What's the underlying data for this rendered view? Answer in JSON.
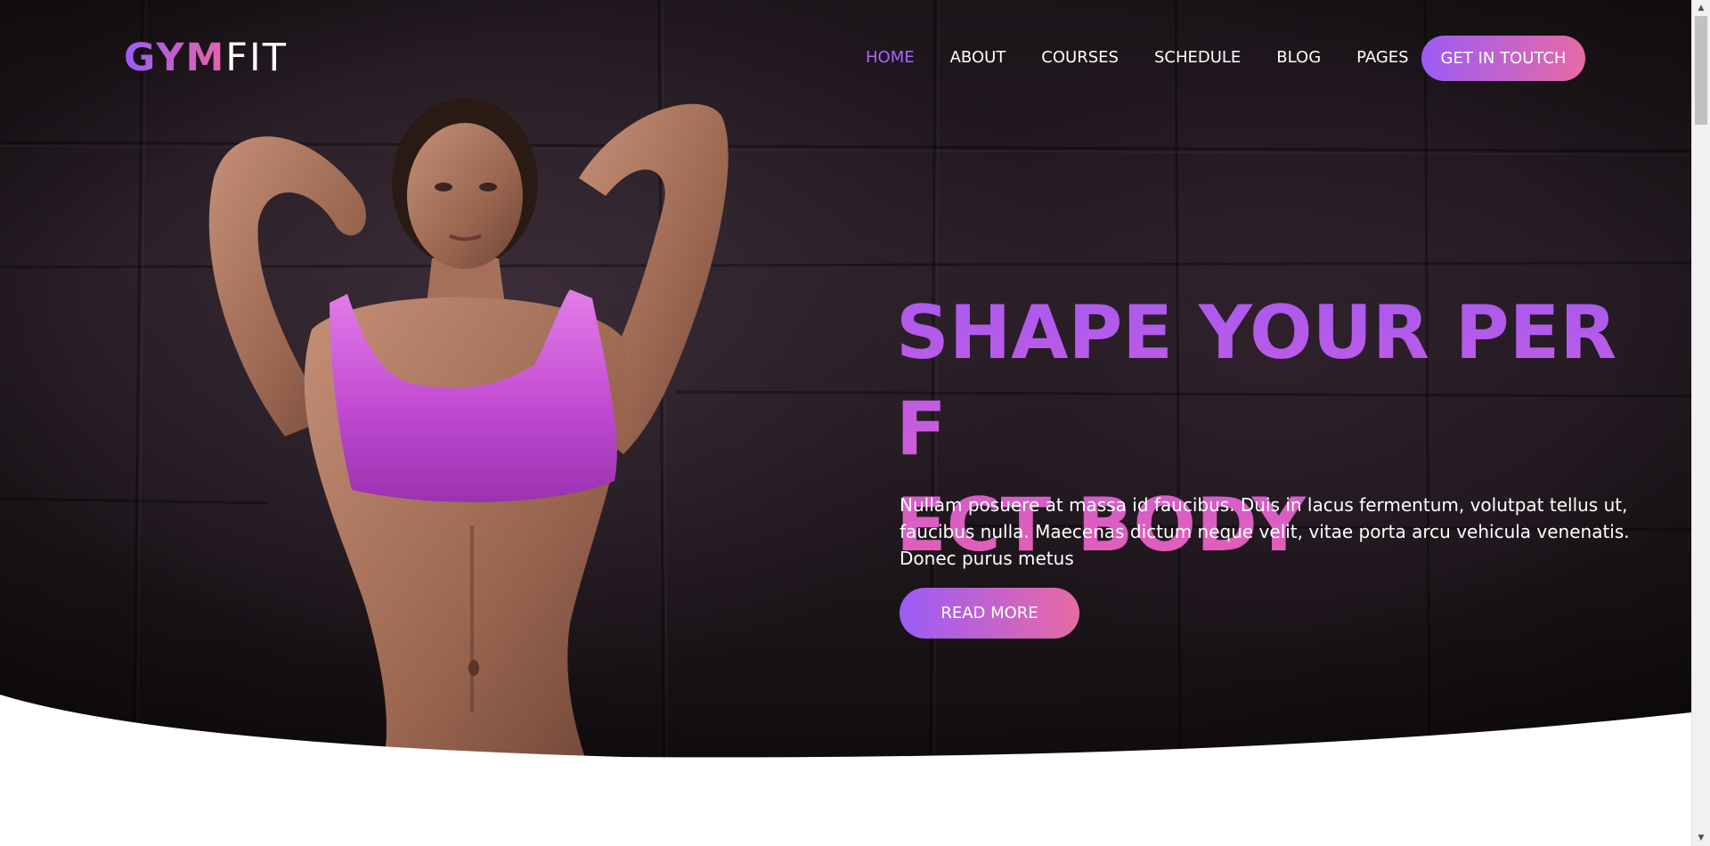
{
  "brand": {
    "logo_part1": "GYM",
    "logo_part2": "FIT"
  },
  "nav": {
    "items": [
      {
        "label": "HOME",
        "active": true
      },
      {
        "label": "ABOUT",
        "active": false
      },
      {
        "label": "COURSES",
        "active": false
      },
      {
        "label": "SCHEDULE",
        "active": false
      },
      {
        "label": "BLOG",
        "active": false
      },
      {
        "label": "PAGES",
        "active": false
      }
    ],
    "cta_label": "GET IN TOUTCH"
  },
  "hero": {
    "headline_line1": "SHAPE YOUR PERF",
    "headline_line2": "ECT BODY",
    "description": "Nullam posuere at massa id faucibus. Duis in lacus fermentum, volutpat tellus ut, faucibus nulla. Maecenas dictum neque velit, vitae porta arcu vehicula venenatis. Donec purus metus",
    "button_label": "READ MORE"
  },
  "colors": {
    "accent_start": "#9b5cf5",
    "accent_end": "#e86aa5",
    "nav_active": "#a766ff",
    "hero_bg": "#1d161b"
  },
  "scrollbar": {
    "up_icon": "scroll-up-arrow-icon",
    "down_icon": "scroll-down-arrow-icon"
  }
}
